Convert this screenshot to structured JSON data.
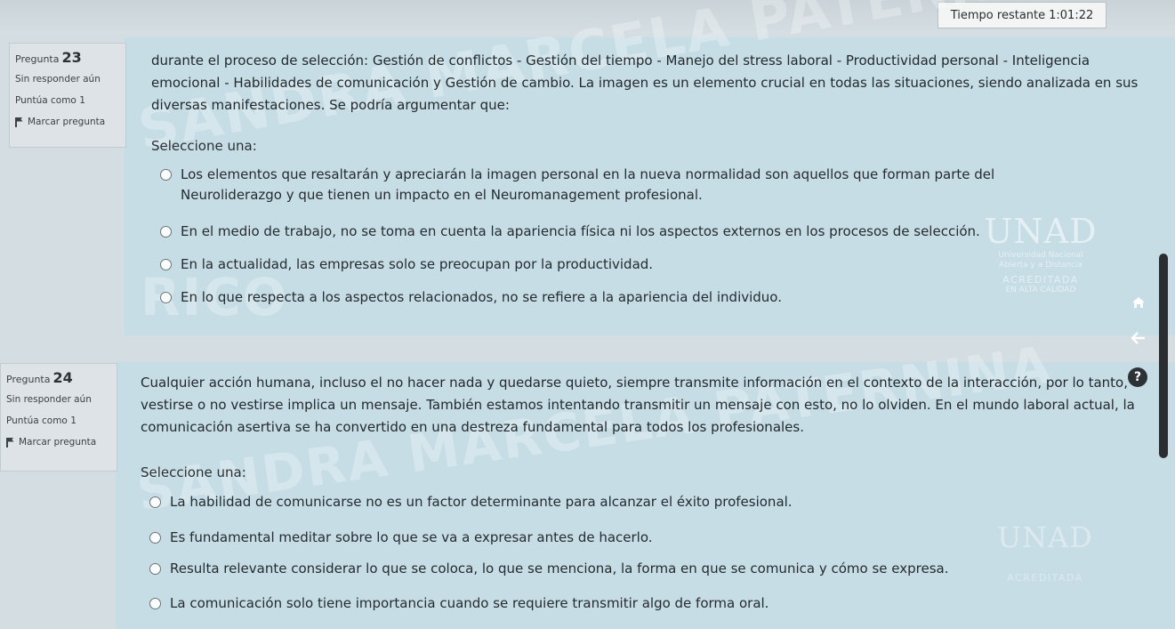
{
  "timer": {
    "label": "Tiempo restante",
    "value": "1:01:22"
  },
  "questions": [
    {
      "label": "Pregunta",
      "number": "23",
      "status": "Sin responder aún",
      "score": "Puntúa como 1",
      "flag": "Marcar pregunta",
      "text_lines": [
        "durante el proceso de selección: Gestión de conflictos - Gestión del tiempo - Manejo del stress laboral - Productividad personal - Inteligencia",
        "emocional - Habilidades de comunicación y Gestión de cambio. La imagen es un elemento crucial en todas las situaciones, siendo analizada en sus",
        "diversas manifestaciones. Se podría argumentar que:"
      ],
      "select_label": "Seleccione una:",
      "options": [
        "Los elementos que resaltarán y apreciarán la imagen personal en la nueva normalidad son aquellos que forman parte del Neuroliderazgo y que tienen un impacto en el Neuromanagement profesional.",
        "En el medio de trabajo, no se toma en cuenta la apariencia física ni los aspectos externos en los procesos de selección.",
        "En la actualidad, las empresas solo se preocupan por la productividad.",
        "En lo que respecta a los aspectos relacionados, no se refiere a la apariencia del individuo."
      ]
    },
    {
      "label": "Pregunta",
      "number": "24",
      "status": "Sin responder aún",
      "score": "Puntúa como 1",
      "flag": "Marcar pregunta",
      "text_lines": [
        "Cualquier acción humana, incluso el no hacer nada y quedarse quieto, siempre transmite información en el contexto de la interacción, por lo tanto,",
        "vestirse o no vestirse implica un mensaje. También estamos intentando transmitir un mensaje con esto, no lo olviden. En el mundo laboral actual, la",
        "comunicación asertiva se ha convertido en una destreza fundamental para todos los profesionales."
      ],
      "select_label": "Seleccione una:",
      "options": [
        "La habilidad de comunicarse no es un factor determinante para alcanzar el éxito profesional.",
        "Es fundamental meditar sobre lo que se va a expresar antes de hacerlo.",
        "Resulta relevante considerar lo que se coloca, lo que se menciona, la forma en que se comunica y cómo se expresa.",
        "La comunicación solo tiene importancia cuando se requiere transmitir algo de forma oral."
      ]
    }
  ],
  "watermark": {
    "line1": "SANDRA MARCELA PATERNINA",
    "line2": "RICO"
  },
  "logo": {
    "name": "UNAD",
    "sub1": "Universidad Nacional",
    "sub2": "Abierta y a Distancia",
    "acred": "ACREDITADA",
    "acred_sub": "EN ALTA CALIDAD"
  },
  "side_buttons": {
    "home_icon": "home-icon",
    "back_icon": "arrow-left-icon",
    "help_icon": "help-icon",
    "help_glyph": "?"
  },
  "colors": {
    "panel": "#c6dde6",
    "info_box": "#dde3e6",
    "background": "#d3dde2"
  }
}
